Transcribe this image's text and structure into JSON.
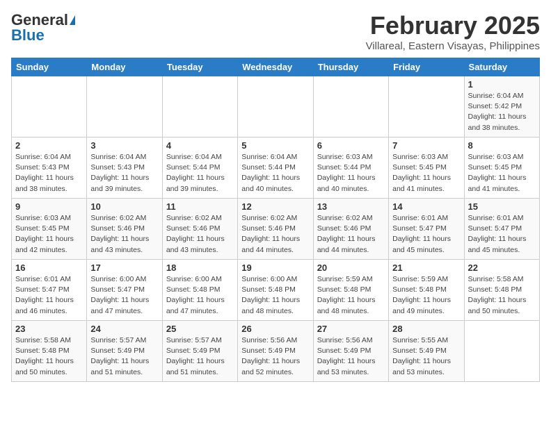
{
  "header": {
    "logo_general": "General",
    "logo_blue": "Blue",
    "main_title": "February 2025",
    "subtitle": "Villareal, Eastern Visayas, Philippines"
  },
  "calendar": {
    "columns": [
      "Sunday",
      "Monday",
      "Tuesday",
      "Wednesday",
      "Thursday",
      "Friday",
      "Saturday"
    ],
    "weeks": [
      [
        {
          "day": "",
          "info": ""
        },
        {
          "day": "",
          "info": ""
        },
        {
          "day": "",
          "info": ""
        },
        {
          "day": "",
          "info": ""
        },
        {
          "day": "",
          "info": ""
        },
        {
          "day": "",
          "info": ""
        },
        {
          "day": "1",
          "info": "Sunrise: 6:04 AM\nSunset: 5:42 PM\nDaylight: 11 hours\nand 38 minutes."
        }
      ],
      [
        {
          "day": "2",
          "info": "Sunrise: 6:04 AM\nSunset: 5:43 PM\nDaylight: 11 hours\nand 38 minutes."
        },
        {
          "day": "3",
          "info": "Sunrise: 6:04 AM\nSunset: 5:43 PM\nDaylight: 11 hours\nand 39 minutes."
        },
        {
          "day": "4",
          "info": "Sunrise: 6:04 AM\nSunset: 5:44 PM\nDaylight: 11 hours\nand 39 minutes."
        },
        {
          "day": "5",
          "info": "Sunrise: 6:04 AM\nSunset: 5:44 PM\nDaylight: 11 hours\nand 40 minutes."
        },
        {
          "day": "6",
          "info": "Sunrise: 6:03 AM\nSunset: 5:44 PM\nDaylight: 11 hours\nand 40 minutes."
        },
        {
          "day": "7",
          "info": "Sunrise: 6:03 AM\nSunset: 5:45 PM\nDaylight: 11 hours\nand 41 minutes."
        },
        {
          "day": "8",
          "info": "Sunrise: 6:03 AM\nSunset: 5:45 PM\nDaylight: 11 hours\nand 41 minutes."
        }
      ],
      [
        {
          "day": "9",
          "info": "Sunrise: 6:03 AM\nSunset: 5:45 PM\nDaylight: 11 hours\nand 42 minutes."
        },
        {
          "day": "10",
          "info": "Sunrise: 6:02 AM\nSunset: 5:46 PM\nDaylight: 11 hours\nand 43 minutes."
        },
        {
          "day": "11",
          "info": "Sunrise: 6:02 AM\nSunset: 5:46 PM\nDaylight: 11 hours\nand 43 minutes."
        },
        {
          "day": "12",
          "info": "Sunrise: 6:02 AM\nSunset: 5:46 PM\nDaylight: 11 hours\nand 44 minutes."
        },
        {
          "day": "13",
          "info": "Sunrise: 6:02 AM\nSunset: 5:46 PM\nDaylight: 11 hours\nand 44 minutes."
        },
        {
          "day": "14",
          "info": "Sunrise: 6:01 AM\nSunset: 5:47 PM\nDaylight: 11 hours\nand 45 minutes."
        },
        {
          "day": "15",
          "info": "Sunrise: 6:01 AM\nSunset: 5:47 PM\nDaylight: 11 hours\nand 45 minutes."
        }
      ],
      [
        {
          "day": "16",
          "info": "Sunrise: 6:01 AM\nSunset: 5:47 PM\nDaylight: 11 hours\nand 46 minutes."
        },
        {
          "day": "17",
          "info": "Sunrise: 6:00 AM\nSunset: 5:47 PM\nDaylight: 11 hours\nand 47 minutes."
        },
        {
          "day": "18",
          "info": "Sunrise: 6:00 AM\nSunset: 5:48 PM\nDaylight: 11 hours\nand 47 minutes."
        },
        {
          "day": "19",
          "info": "Sunrise: 6:00 AM\nSunset: 5:48 PM\nDaylight: 11 hours\nand 48 minutes."
        },
        {
          "day": "20",
          "info": "Sunrise: 5:59 AM\nSunset: 5:48 PM\nDaylight: 11 hours\nand 48 minutes."
        },
        {
          "day": "21",
          "info": "Sunrise: 5:59 AM\nSunset: 5:48 PM\nDaylight: 11 hours\nand 49 minutes."
        },
        {
          "day": "22",
          "info": "Sunrise: 5:58 AM\nSunset: 5:48 PM\nDaylight: 11 hours\nand 50 minutes."
        }
      ],
      [
        {
          "day": "23",
          "info": "Sunrise: 5:58 AM\nSunset: 5:48 PM\nDaylight: 11 hours\nand 50 minutes."
        },
        {
          "day": "24",
          "info": "Sunrise: 5:57 AM\nSunset: 5:49 PM\nDaylight: 11 hours\nand 51 minutes."
        },
        {
          "day": "25",
          "info": "Sunrise: 5:57 AM\nSunset: 5:49 PM\nDaylight: 11 hours\nand 51 minutes."
        },
        {
          "day": "26",
          "info": "Sunrise: 5:56 AM\nSunset: 5:49 PM\nDaylight: 11 hours\nand 52 minutes."
        },
        {
          "day": "27",
          "info": "Sunrise: 5:56 AM\nSunset: 5:49 PM\nDaylight: 11 hours\nand 53 minutes."
        },
        {
          "day": "28",
          "info": "Sunrise: 5:55 AM\nSunset: 5:49 PM\nDaylight: 11 hours\nand 53 minutes."
        },
        {
          "day": "",
          "info": ""
        }
      ]
    ]
  }
}
